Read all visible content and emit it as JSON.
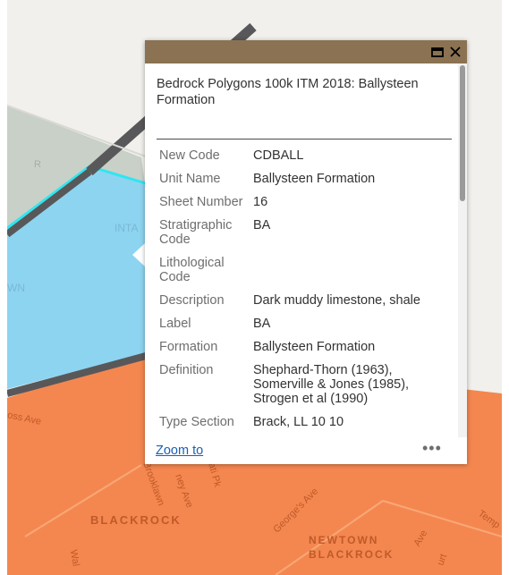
{
  "popup": {
    "title": "Bedrock Polygons 100k ITM 2018: Ballysteen Formation",
    "fields": [
      {
        "key": "New Code",
        "value": "CDBALL"
      },
      {
        "key": "Unit Name",
        "value": "Ballysteen Formation"
      },
      {
        "key": "Sheet Number",
        "value": "16"
      },
      {
        "key": "Stratigraphic Code",
        "value": "BA"
      },
      {
        "key": "Lithological Code",
        "value": ""
      },
      {
        "key": "Description",
        "value": "Dark muddy limestone, shale"
      },
      {
        "key": "Label",
        "value": "BA"
      },
      {
        "key": "Formation",
        "value": "Ballysteen Formation"
      },
      {
        "key": "Definition",
        "value": "Shephard-Thorn (1963), Somerville & Jones (1985), Strogen et al (1990)"
      },
      {
        "key": "Type Section",
        "value": "Brack, LL 10 10"
      }
    ],
    "zoom_label": "Zoom to",
    "more_label": "•••",
    "header_color": "#8b7252"
  },
  "map": {
    "labels": {
      "blackrock": "BLACKROCK",
      "newtown": "NEWTOWN",
      "blackrock2": "BLACKROCK",
      "inta": "INTA",
      "wn": "WN",
      "ross_ave": "oss Ave",
      "brooklawn": "Brooklawn",
      "ney_ave": "ney Ave",
      "georges_ave": "George's Ave",
      "temp": "Temp",
      "wal": "Wal",
      "ave": "Ave",
      "court": "urt",
      "ati_pk": "ati Pk",
      "r": "R"
    },
    "colors": {
      "orange": "#f4874f",
      "blue": "#8dd4f0",
      "cyan_outline": "#2ee6f0",
      "dark_band": "#58585a",
      "grey": "#c9d0c8"
    }
  }
}
